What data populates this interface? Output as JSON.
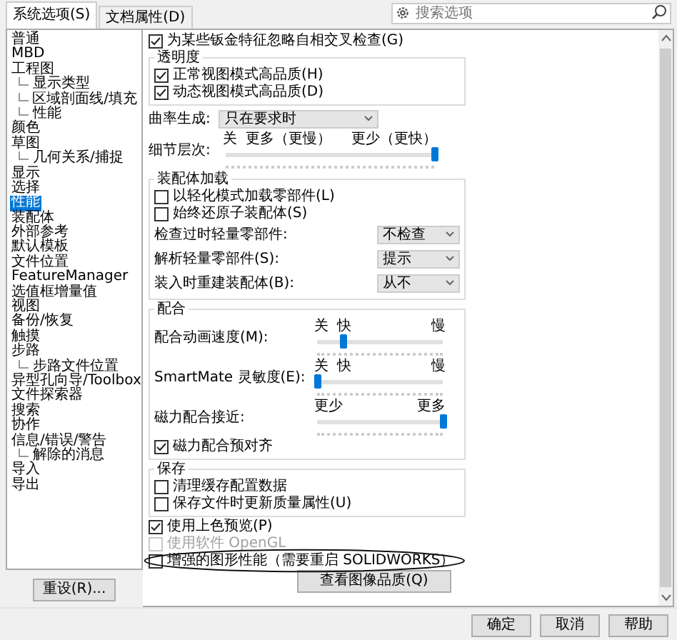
{
  "tabs": [
    {
      "label": "系统选项(S)",
      "selected": true
    },
    {
      "label": "文档属性(D)",
      "selected": false
    }
  ],
  "search": {
    "placeholder": "搜索选项"
  },
  "tree": [
    {
      "label": "普通",
      "selected": false
    },
    {
      "label": "MBD",
      "selected": false
    },
    {
      "label": "工程图",
      "selected": false,
      "children": [
        {
          "label": "显示类型",
          "selected": false
        },
        {
          "label": "区域剖面线/填充",
          "selected": false
        },
        {
          "label": "性能",
          "selected": false
        }
      ]
    },
    {
      "label": "颜色",
      "selected": false
    },
    {
      "label": "草图",
      "selected": false,
      "children": [
        {
          "label": "几何关系/捕捉",
          "selected": false
        }
      ]
    },
    {
      "label": "显示",
      "selected": false
    },
    {
      "label": "选择",
      "selected": false
    },
    {
      "label": "性能",
      "selected": true
    },
    {
      "label": "装配体",
      "selected": false
    },
    {
      "label": "外部参考",
      "selected": false
    },
    {
      "label": "默认模板",
      "selected": false
    },
    {
      "label": "文件位置",
      "selected": false
    },
    {
      "label": "FeatureManager",
      "selected": false
    },
    {
      "label": "选值框增量值",
      "selected": false
    },
    {
      "label": "视图",
      "selected": false
    },
    {
      "label": "备份/恢复",
      "selected": false
    },
    {
      "label": "触摸",
      "selected": false
    },
    {
      "label": "步路",
      "selected": false,
      "children": [
        {
          "label": "步路文件位置",
          "selected": false
        }
      ]
    },
    {
      "label": "异型孔向导/Toolbox",
      "selected": false
    },
    {
      "label": "文件探索器",
      "selected": false
    },
    {
      "label": "搜索",
      "selected": false
    },
    {
      "label": "协作",
      "selected": false
    },
    {
      "label": "信息/错误/警告",
      "selected": false,
      "children": [
        {
          "label": "解除的消息",
          "selected": false
        }
      ]
    },
    {
      "label": "导入",
      "selected": false
    },
    {
      "label": "导出",
      "selected": false
    }
  ],
  "reset_button": "重设(R)...",
  "options": [
    {
      "kind": "checkbox",
      "label": "为某些钣金特征忽略自相交叉检查(G)",
      "checked": true,
      "disabled": false,
      "circled": false
    },
    {
      "kind": "group",
      "title": "透明度",
      "items": [
        {
          "kind": "checkbox",
          "label": "正常视图模式高品质(H)",
          "checked": true,
          "disabled": false,
          "circled": false
        },
        {
          "kind": "checkbox",
          "label": "动态视图模式高品质(D)",
          "checked": true,
          "disabled": false,
          "circled": false
        }
      ]
    },
    {
      "kind": "dropdown",
      "label": "曲率生成:",
      "value": "只在要求时"
    },
    {
      "kind": "slider",
      "label": "细节层次:",
      "marks": [
        "关",
        "更多（更慢）",
        "更少（更快）"
      ],
      "level": 1
    },
    {
      "kind": "group",
      "title": "装配体加载",
      "items": [
        {
          "kind": "checkbox",
          "label": "以轻化模式加载零部件(L)",
          "checked": false,
          "disabled": false,
          "circled": false
        },
        {
          "kind": "checkbox",
          "label": "始终还原子装配体(S)",
          "checked": false,
          "disabled": false,
          "circled": false
        },
        {
          "kind": "select",
          "label": "检查过时轻量零部件:",
          "value": "不检查"
        },
        {
          "kind": "select",
          "label": "解析轻量零部件(S):",
          "value": "提示"
        },
        {
          "kind": "select",
          "label": "装入时重建装配体(B):",
          "value": "从不"
        }
      ]
    },
    {
      "kind": "group",
      "title": "配合",
      "items": [
        {
          "kind": "slider",
          "label": "配合动画速度(M):",
          "marks": [
            "关",
            "快",
            "慢"
          ],
          "level": 0.2
        },
        {
          "kind": "slider",
          "label": "SmartMate 灵敏度(E):",
          "marks": [
            "关",
            "快",
            "慢"
          ],
          "level": 0
        },
        {
          "kind": "slider",
          "label": "磁力配合接近:",
          "marks": [
            "更少",
            "更多"
          ],
          "level": 1
        },
        {
          "kind": "checkbox",
          "label": "磁力配合预对齐",
          "checked": true,
          "disabled": false,
          "circled": false
        }
      ]
    },
    {
      "kind": "group",
      "title": "保存",
      "items": [
        {
          "kind": "checkbox",
          "label": "清理缓存配置数据",
          "checked": false,
          "disabled": false,
          "circled": false
        },
        {
          "kind": "checkbox",
          "label": "保存文件时更新质量属性(U)",
          "checked": false,
          "disabled": false,
          "circled": false
        }
      ]
    },
    {
      "kind": "checkbox",
      "label": "使用上色预览(P)",
      "checked": true,
      "disabled": false,
      "circled": false
    },
    {
      "kind": "checkbox",
      "label": "使用软件 OpenGL",
      "checked": false,
      "disabled": true,
      "circled": false
    },
    {
      "kind": "checkbox",
      "label": "增强的图形性能（需要重启 SOLIDWORKS）",
      "checked": false,
      "disabled": false,
      "circled": true
    },
    {
      "kind": "button",
      "label": "查看图像品质(Q)"
    }
  ],
  "buttons": [
    "确定",
    "取消",
    "帮助"
  ]
}
